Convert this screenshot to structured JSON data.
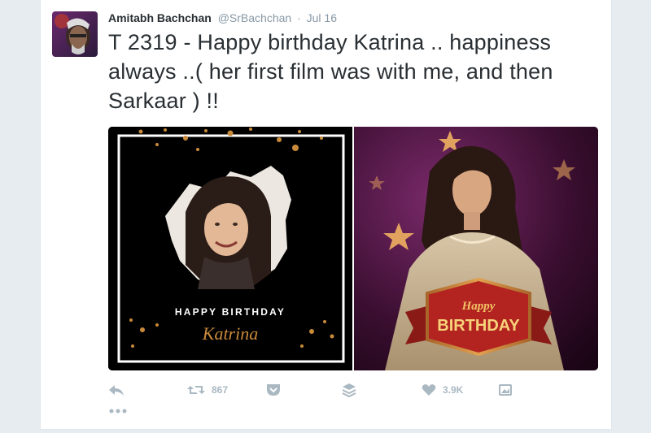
{
  "tweet": {
    "author_name": "Amitabh Bachchan",
    "author_handle": "@SrBachchan",
    "separator": "·",
    "date": "Jul 16",
    "text": "T 2319 - Happy birthday Katrina .. happiness always ..( her first film was with me, and then Sarkaar ) !!"
  },
  "media": {
    "left_card": {
      "line1": "HAPPY BIRTHDAY",
      "line2": "Katrina"
    },
    "right_card": {
      "line1": "Happy",
      "line2": "BIRTHDAY"
    }
  },
  "actions": {
    "reply_icon": "reply-icon",
    "retweet_icon": "retweet-icon",
    "retweet_count": "867",
    "pocket_icon": "pocket-icon",
    "buffer_icon": "buffer-icon",
    "like_icon": "heart-icon",
    "like_count": "3.9K",
    "media_icon": "image-icon",
    "more_icon": "more-dots-icon"
  },
  "colors": {
    "text": "#292f33",
    "muted": "#8899a6",
    "icon": "#aab8c2",
    "gold": "#c98a3a",
    "ribbon_red": "#b32420"
  }
}
